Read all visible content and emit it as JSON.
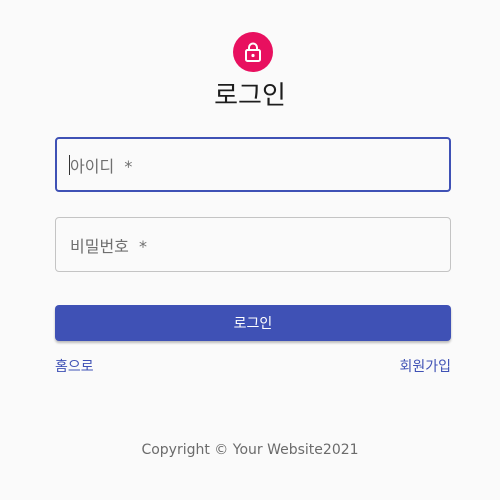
{
  "header": {
    "icon": "lock-icon",
    "accent_color": "#e8105f",
    "title": "로그인"
  },
  "form": {
    "id_field": {
      "label": "아이디  *",
      "value": "",
      "state": "focused"
    },
    "password_field": {
      "label": "비밀번호  *",
      "value": ""
    },
    "submit_label": "로그인"
  },
  "links": {
    "home": "홈으로",
    "signup": "회원가입"
  },
  "footer": {
    "copyright": "Copyright © Your Website2021"
  },
  "colors": {
    "primary": "#3f51b5",
    "background": "#fafafa"
  }
}
